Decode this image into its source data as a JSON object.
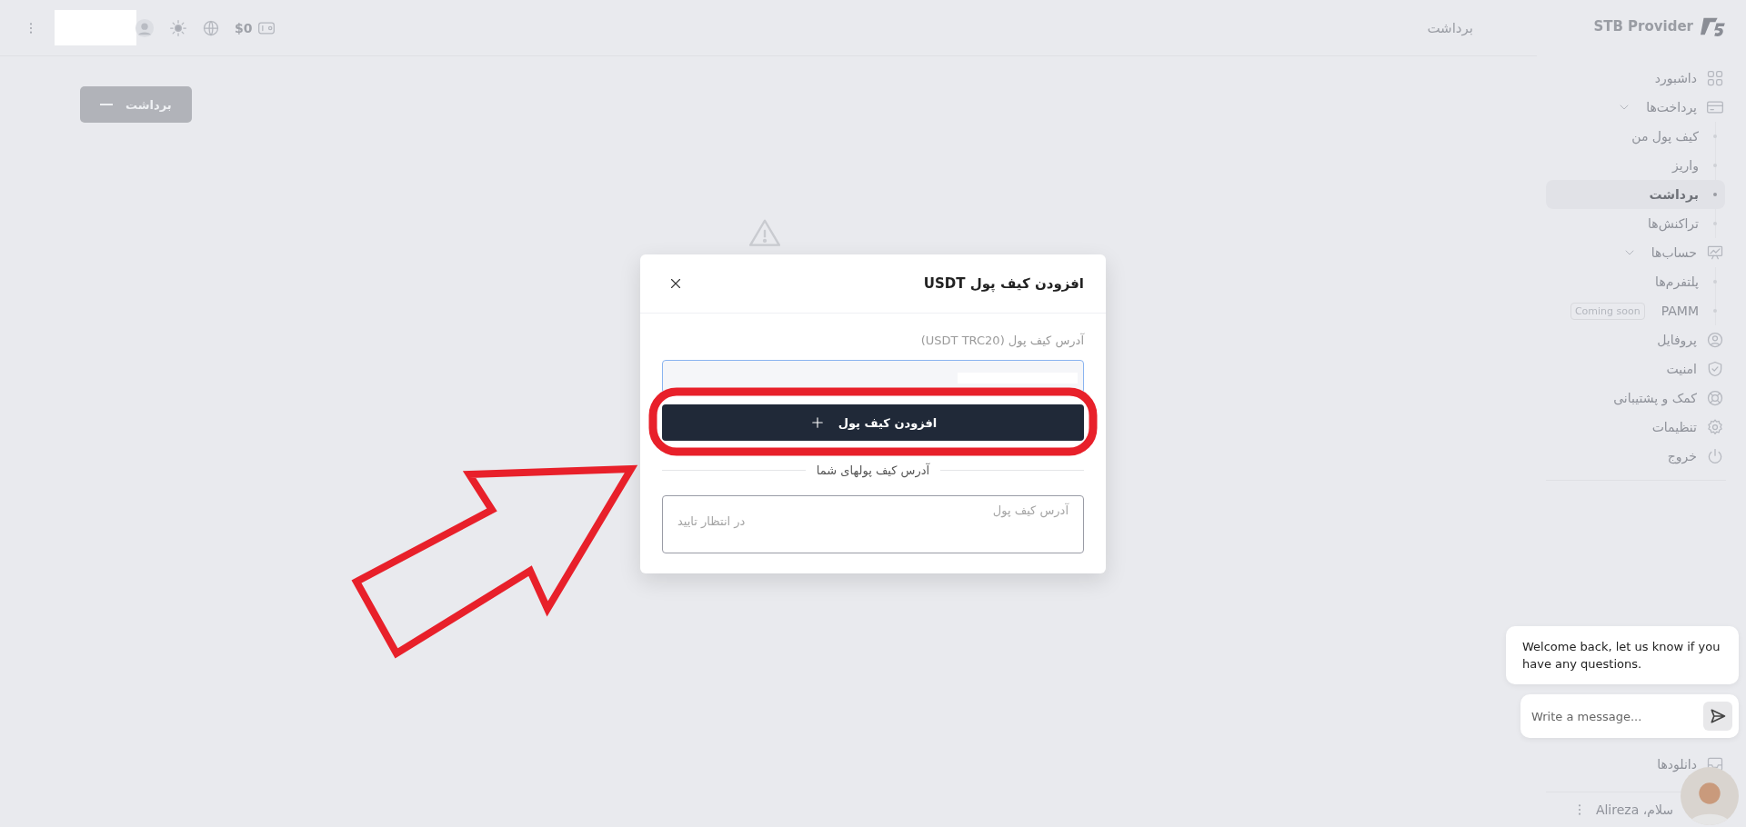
{
  "top_bar": {
    "balance": "$0",
    "page_title": "برداشت"
  },
  "main": {
    "withdraw_button": "برداشت"
  },
  "sidebar": {
    "brand": "STB Provider",
    "items": [
      {
        "label": "داشبورد",
        "kind": "link"
      },
      {
        "label": "پرداخت‌ها",
        "kind": "group",
        "expanded": true,
        "children": [
          {
            "label": "کیف پول من",
            "selected": false
          },
          {
            "label": "واریز",
            "selected": false
          },
          {
            "label": "برداشت",
            "selected": true
          },
          {
            "label": "تراکنش‌ها",
            "selected": false
          }
        ]
      },
      {
        "label": "حساب‌ها",
        "kind": "group",
        "expanded": true,
        "children": [
          {
            "label": "پلتفرم‌ها",
            "selected": false
          },
          {
            "label": "PAMM",
            "badge": "Coming soon",
            "selected": false
          }
        ]
      },
      {
        "label": "پروفایل",
        "kind": "link"
      },
      {
        "label": "امنیت",
        "kind": "link"
      },
      {
        "label": "کمک و پشتیبانی",
        "kind": "link"
      },
      {
        "label": "تنظیمات",
        "kind": "link"
      },
      {
        "label": "خروج",
        "kind": "link"
      }
    ],
    "bottom_items": [
      {
        "label": "دانلودها"
      }
    ],
    "greeting": "سلام، Alireza"
  },
  "dialog": {
    "title": "افزودن کیف پول USDT",
    "field_label": "آدرس کیف پول (USDT TRC20)",
    "add_button": "افزودن کیف پول",
    "section_title": "آدرس کیف پولهای شما",
    "wallets": [
      {
        "label": "آدرس کیف پول",
        "status": "در انتظار تایید"
      }
    ]
  },
  "chat": {
    "message": "Welcome back, let us know if you have any questions.",
    "placeholder": "Write a message..."
  }
}
